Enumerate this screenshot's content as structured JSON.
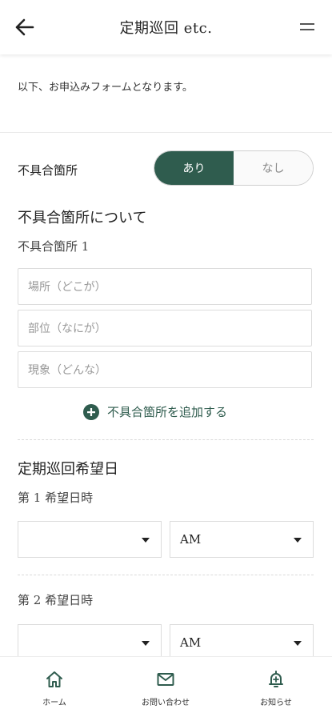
{
  "header": {
    "title": "定期巡回 etc.",
    "back_icon": "back-arrow-icon",
    "menu_icon": "hamburger-menu-icon"
  },
  "intro": "以下、お申込みフォームとなります。",
  "defect": {
    "label": "不具合箇所",
    "toggle_on": "あり",
    "toggle_off": "なし",
    "selected": "あり"
  },
  "defect_section": {
    "title": "不具合箇所について",
    "item_label": "不具合箇所 1",
    "fields": [
      {
        "placeholder": "場所（どこが）"
      },
      {
        "placeholder": "部位（なにが）"
      },
      {
        "placeholder": "現象（どんな）"
      }
    ],
    "add_label": "不具合箇所を追加する"
  },
  "schedule": {
    "title": "定期巡回希望日",
    "slots": [
      {
        "label": "第 1 希望日時",
        "date_value": "",
        "period_value": "AM"
      },
      {
        "label": "第 2 希望日時",
        "date_value": "",
        "period_value": "AM"
      }
    ]
  },
  "tabbar": {
    "items": [
      {
        "label": "ホーム",
        "icon": "home-icon"
      },
      {
        "label": "お問い合わせ",
        "icon": "mail-icon"
      },
      {
        "label": "お知らせ",
        "icon": "bell-icon"
      }
    ]
  },
  "colors": {
    "accent": "#2f5c4e",
    "border": "#dcdcdc",
    "placeholder": "#999999"
  }
}
